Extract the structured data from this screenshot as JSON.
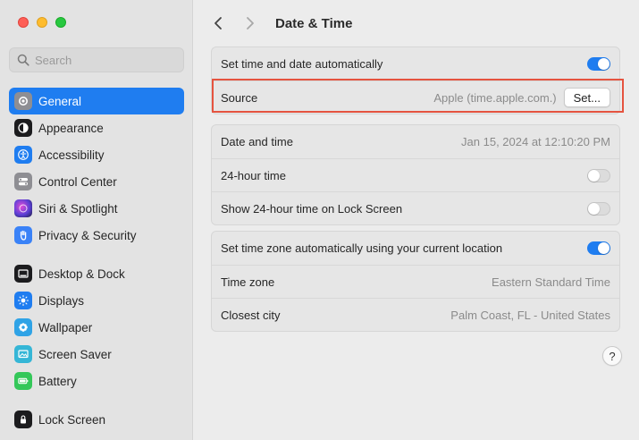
{
  "window": {
    "traffic_lights": [
      "close",
      "minimize",
      "zoom"
    ]
  },
  "sidebar": {
    "search": {
      "placeholder": "Search",
      "value": ""
    },
    "groups": [
      [
        {
          "label": "General",
          "icon": "gear-icon",
          "color": "#8e8e93",
          "active": true
        },
        {
          "label": "Appearance",
          "icon": "appearance-icon",
          "color": "#1c1c1e"
        },
        {
          "label": "Accessibility",
          "icon": "accessibility-icon",
          "color": "#1f7df0"
        },
        {
          "label": "Control Center",
          "icon": "control-center-icon",
          "color": "#8e8e93"
        },
        {
          "label": "Siri & Spotlight",
          "icon": "siri-icon",
          "color": "#5b3fd6"
        },
        {
          "label": "Privacy & Security",
          "icon": "hand-icon",
          "color": "#3a82f7"
        }
      ],
      [
        {
          "label": "Desktop & Dock",
          "icon": "dock-icon",
          "color": "#1c1c1e"
        },
        {
          "label": "Displays",
          "icon": "displays-icon",
          "color": "#1f7df0"
        },
        {
          "label": "Wallpaper",
          "icon": "wallpaper-icon",
          "color": "#2fa3e6"
        },
        {
          "label": "Screen Saver",
          "icon": "screen-saver-icon",
          "color": "#35b6d6"
        },
        {
          "label": "Battery",
          "icon": "battery-icon",
          "color": "#34c759"
        }
      ],
      [
        {
          "label": "Lock Screen",
          "icon": "lock-icon",
          "color": "#1c1c1e"
        }
      ]
    ]
  },
  "main": {
    "title": "Date & Time",
    "group1": {
      "auto_label": "Set time and date automatically",
      "auto_on": true,
      "source_label": "Source",
      "source_value": "Apple (time.apple.com.)",
      "set_button": "Set..."
    },
    "group2": {
      "datetime_label": "Date and time",
      "datetime_value": "Jan 15, 2024 at 12:10:20 PM",
      "h24_label": "24-hour time",
      "h24_on": false,
      "lock_label": "Show 24-hour time on Lock Screen",
      "lock_on": false
    },
    "group3": {
      "tz_auto_label": "Set time zone automatically using your current location",
      "tz_auto_on": true,
      "tz_label": "Time zone",
      "tz_value": "Eastern Standard Time",
      "city_label": "Closest city",
      "city_value": "Palm Coast, FL - United States"
    },
    "help_label": "?"
  },
  "colors": {
    "accent": "#1f7df0",
    "highlight": "#e5533f"
  }
}
